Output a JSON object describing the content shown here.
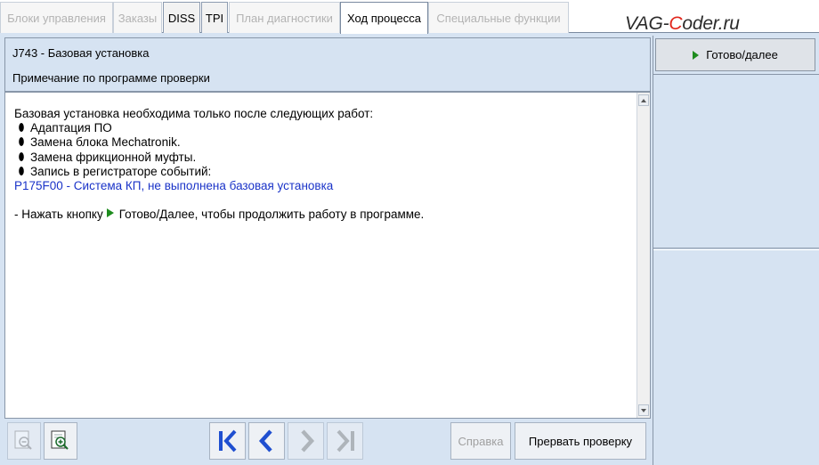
{
  "tabs": [
    {
      "label": "Блоки управления",
      "state": "disabled"
    },
    {
      "label": "Заказы",
      "state": "disabled"
    },
    {
      "label": "DISS",
      "state": "enabled"
    },
    {
      "label": "TPI",
      "state": "enabled"
    },
    {
      "label": "План диагностики",
      "state": "disabled"
    },
    {
      "label": "Ход процесса",
      "state": "active"
    },
    {
      "label": "Специальные функции",
      "state": "disabled"
    }
  ],
  "watermark": {
    "pre": "VAG-",
    "accent": "C",
    "post": "oder.ru"
  },
  "header": {
    "title": "J743 - Базовая установка",
    "subtitle": "Примечание по программе проверки"
  },
  "content": {
    "intro": "Базовая установка необходима только после следующих работ:",
    "bullets": [
      "Адаптация ПО",
      "Замена блока Mechatronik.",
      "Замена фрикционной муфты.",
      "Запись в регистраторе событий:"
    ],
    "fault_line": "P175F00 - Система КП, не выполнена базовая установка",
    "instruction_before": "- Нажать кнопку",
    "instruction_after": "Готово/Далее, чтобы продолжить работу в программе."
  },
  "toolbar": {
    "help_label": "Справка",
    "abort_label": "Прервать проверку"
  },
  "right_panel": {
    "ready_label": "Готово/далее"
  },
  "colors": {
    "background": "#d6e3f2",
    "fault_text": "#1a33c8",
    "play_green": "#1e8c1e",
    "nav_blue": "#1f4fd0",
    "watermark_accent": "#e1261c"
  }
}
